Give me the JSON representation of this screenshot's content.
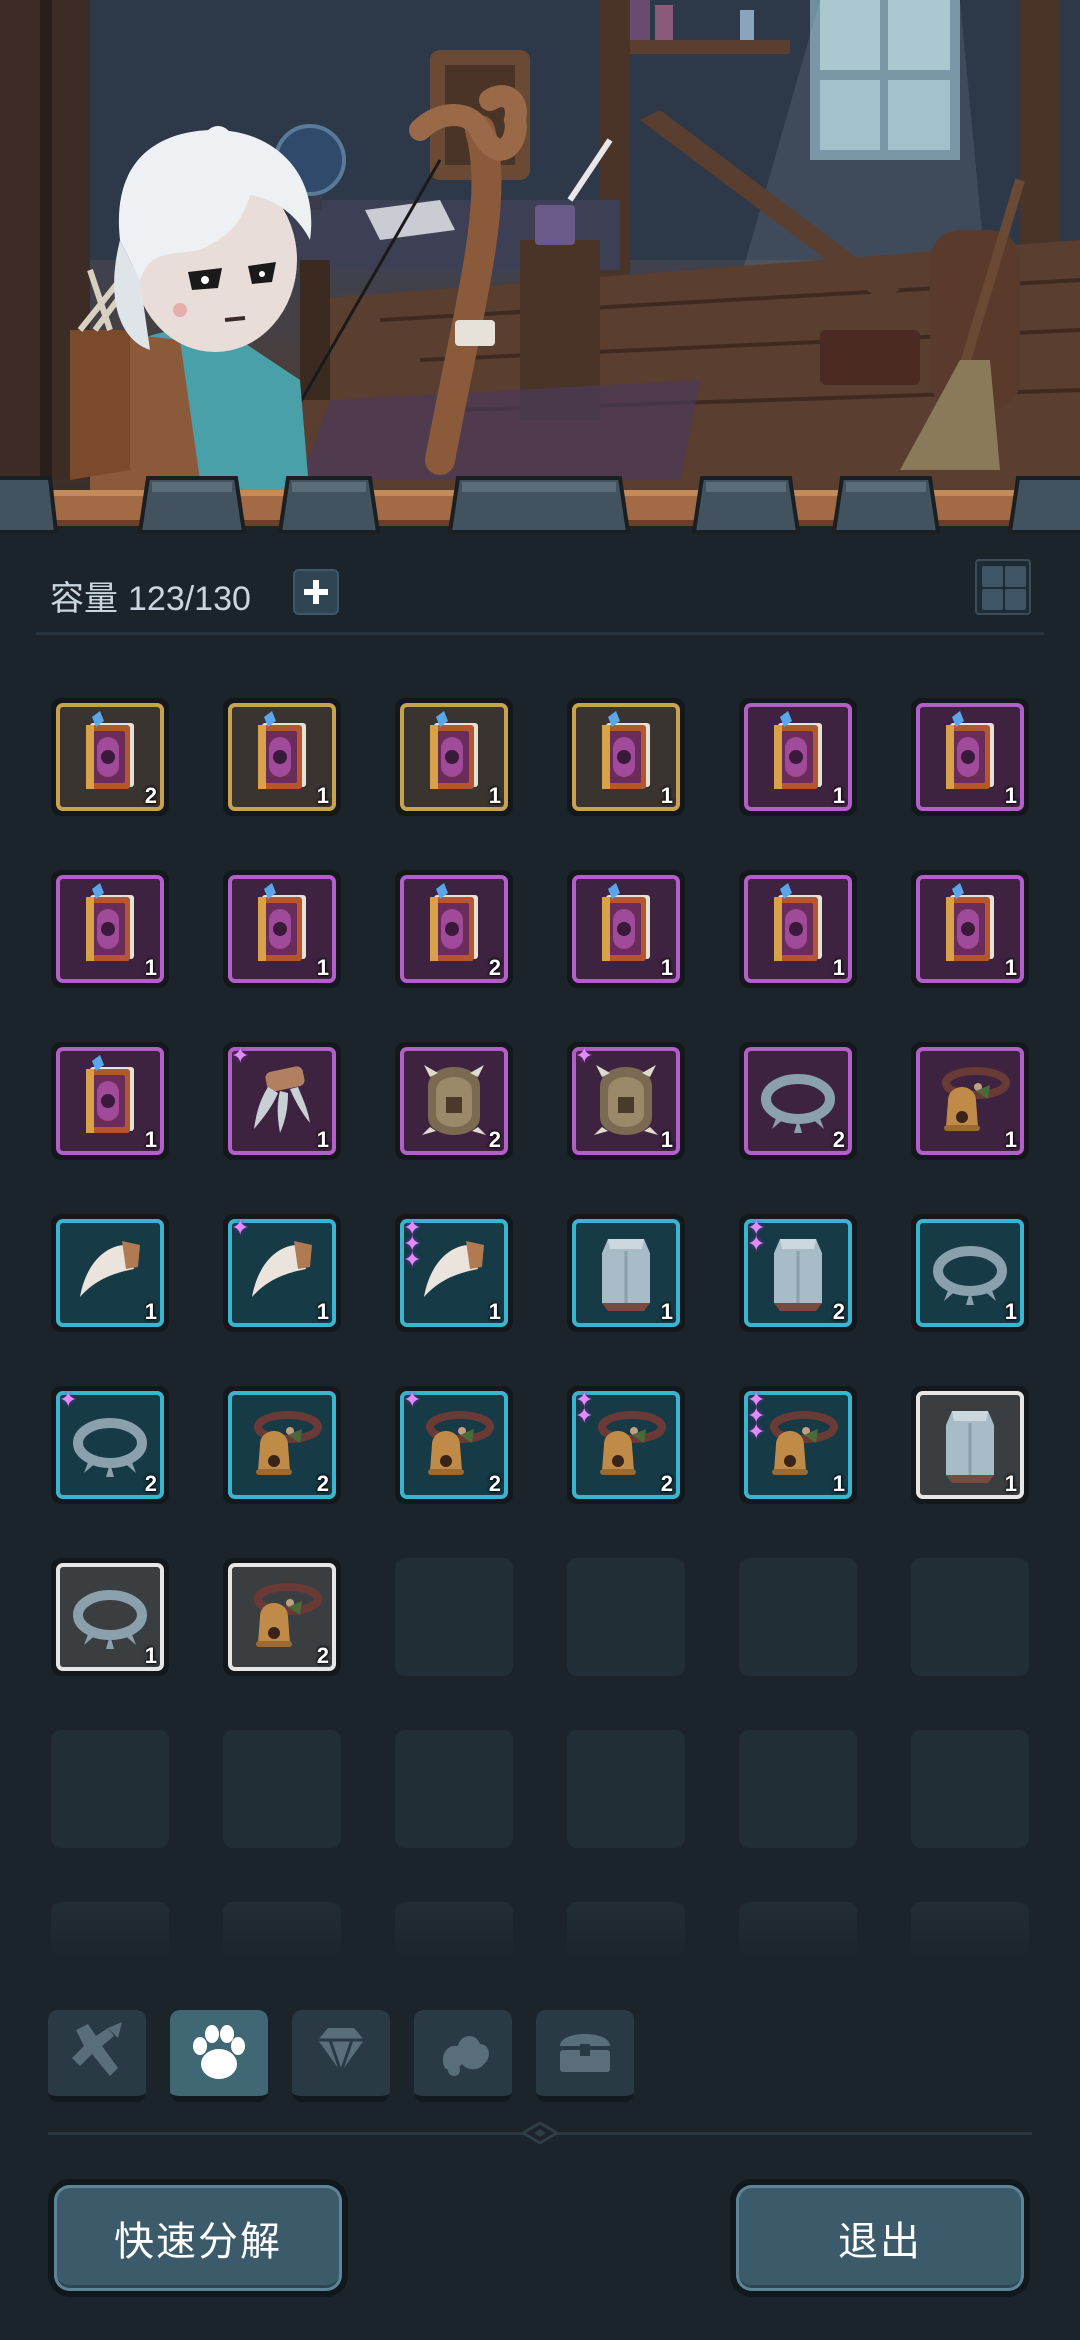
{
  "header": {
    "capacity_label": "容量",
    "capacity_value": "123/130",
    "plus_icon": "plus-icon",
    "grid_icon": "grid-view-icon"
  },
  "inventory": [
    {
      "type": "book",
      "rarity": "gold",
      "count": "2",
      "stars": 0
    },
    {
      "type": "book",
      "rarity": "gold",
      "count": "1",
      "stars": 0
    },
    {
      "type": "book",
      "rarity": "gold",
      "count": "1",
      "stars": 0
    },
    {
      "type": "book",
      "rarity": "gold",
      "count": "1",
      "stars": 0
    },
    {
      "type": "book",
      "rarity": "purple",
      "count": "1",
      "stars": 0
    },
    {
      "type": "book",
      "rarity": "purple",
      "count": "1",
      "stars": 0
    },
    {
      "type": "book",
      "rarity": "purple",
      "count": "1",
      "stars": 0
    },
    {
      "type": "book",
      "rarity": "purple",
      "count": "1",
      "stars": 0
    },
    {
      "type": "book",
      "rarity": "purple",
      "count": "2",
      "stars": 0
    },
    {
      "type": "book",
      "rarity": "purple",
      "count": "1",
      "stars": 0
    },
    {
      "type": "book",
      "rarity": "purple",
      "count": "1",
      "stars": 0
    },
    {
      "type": "book",
      "rarity": "purple",
      "count": "1",
      "stars": 0
    },
    {
      "type": "book",
      "rarity": "purple",
      "count": "1",
      "stars": 0
    },
    {
      "type": "claw",
      "rarity": "purple",
      "count": "1",
      "stars": 1
    },
    {
      "type": "armor",
      "rarity": "purple",
      "count": "2",
      "stars": 0
    },
    {
      "type": "armor",
      "rarity": "purple",
      "count": "1",
      "stars": 1
    },
    {
      "type": "ring",
      "rarity": "purple",
      "count": "2",
      "stars": 0
    },
    {
      "type": "bell",
      "rarity": "purple",
      "count": "1",
      "stars": 0
    },
    {
      "type": "fang",
      "rarity": "blue",
      "count": "1",
      "stars": 0
    },
    {
      "type": "fang",
      "rarity": "blue",
      "count": "1",
      "stars": 1
    },
    {
      "type": "fang",
      "rarity": "blue",
      "count": "1",
      "stars": 3
    },
    {
      "type": "vest",
      "rarity": "blue",
      "count": "1",
      "stars": 0
    },
    {
      "type": "vest",
      "rarity": "blue",
      "count": "2",
      "stars": 2
    },
    {
      "type": "ring",
      "rarity": "blue",
      "count": "1",
      "stars": 0
    },
    {
      "type": "ring",
      "rarity": "blue",
      "count": "2",
      "stars": 1
    },
    {
      "type": "bell",
      "rarity": "blue",
      "count": "2",
      "stars": 0
    },
    {
      "type": "bell",
      "rarity": "blue",
      "count": "2",
      "stars": 1
    },
    {
      "type": "bell",
      "rarity": "blue",
      "count": "2",
      "stars": 2
    },
    {
      "type": "bell",
      "rarity": "blue",
      "count": "1",
      "stars": 3
    },
    {
      "type": "vest",
      "rarity": "white",
      "count": "1",
      "stars": 0
    },
    {
      "type": "ring",
      "rarity": "white",
      "count": "1",
      "stars": 0
    },
    {
      "type": "bell",
      "rarity": "white",
      "count": "2",
      "stars": 0
    }
  ],
  "empty_slots": 16,
  "tabs": [
    {
      "icon": "weapon-icon",
      "active": false
    },
    {
      "icon": "paw-icon",
      "active": true
    },
    {
      "icon": "gem-icon",
      "active": false
    },
    {
      "icon": "material-icon",
      "active": false
    },
    {
      "icon": "chest-icon",
      "active": false
    }
  ],
  "buttons": {
    "decompose": "快速分解",
    "exit": "退出"
  },
  "colors": {
    "gold": "#c9a24f",
    "purple": "#b35ec9",
    "blue": "#3bb5cf",
    "white": "#e6e6e6",
    "star": "#e08cff"
  }
}
